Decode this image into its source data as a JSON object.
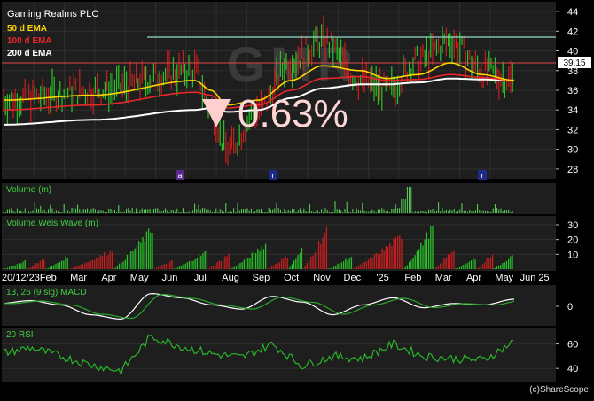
{
  "title": "Gaming Realms PLC",
  "watermark": "GMR",
  "change_text": "0.63%",
  "copyright": "(c)ShareScope",
  "legend": [
    {
      "label": "50 d  EMA",
      "color": "#ffd400"
    },
    {
      "label": "100 d  EMA",
      "color": "#e8262b"
    },
    {
      "label": "200 d  EMA",
      "color": "#ffffff"
    }
  ],
  "panel_labels": {
    "volume": "Volume (m)",
    "weis": "Volume Weis Wave (m)",
    "macd": "13, 26 (9 sig) MACD",
    "rsi": "20 RSI"
  },
  "event_markers": [
    "a",
    "r",
    "r"
  ],
  "colors": {
    "background": "#000000",
    "panel_bg": "#1e1e1e",
    "up_bar": "#28c228",
    "down_bar": "#c81e1e",
    "resistance_line": "#8fe0c8",
    "last_price_line": "#e04848",
    "price_tag_bg": "#ffffff",
    "marker_bg": "#4a2a7a"
  },
  "chart_data": [
    {
      "type": "line",
      "title": "Gaming Realms PLC",
      "series": [
        {
          "name": "50 d  EMA"
        },
        {
          "name": "100 d  EMA"
        },
        {
          "name": "200 d  EMA"
        }
      ],
      "x_ticks": [
        "20/12/23",
        "Feb",
        "Mar",
        "Apr",
        "May",
        "Jun",
        "Jul",
        "Aug",
        "Sep",
        "Oct",
        "Nov",
        "Dec",
        "'25",
        "Feb",
        "Mar",
        "Apr",
        "May",
        "Jun 25"
      ],
      "y_ticks": [
        28,
        30,
        32,
        34,
        36,
        38,
        40,
        42,
        44
      ],
      "ylim": [
        27,
        45
      ],
      "last_price": "39.15",
      "resistance_level": 41.6,
      "price_path_x": [
        0,
        2.8,
        6,
        6.5,
        7,
        8,
        9,
        10,
        11.2,
        12,
        13,
        14,
        15,
        16
      ],
      "price_path_y": [
        35,
        36,
        38,
        34,
        30,
        34,
        39,
        41,
        37,
        36,
        39,
        41,
        38,
        37
      ],
      "ema50_path": [
        35,
        35.5,
        37,
        36,
        34.5,
        35,
        37,
        38.5,
        38,
        37.2,
        37.6,
        38.8,
        37.6,
        37
      ],
      "ema100_path": [
        34,
        34.5,
        35.8,
        35.5,
        34.2,
        34.5,
        36,
        37.2,
        37.4,
        37,
        37.1,
        37.6,
        37.3,
        37
      ],
      "ema200_path": [
        32.5,
        33,
        34,
        34.2,
        33.8,
        34,
        35.2,
        36.2,
        36.6,
        36.6,
        36.8,
        37.2,
        37.1,
        37
      ]
    },
    {
      "type": "bar",
      "title": "Volume (m)",
      "y_ticks": [],
      "spike_index": 12.6
    },
    {
      "type": "bar",
      "title": "Volume Weis Wave (m)",
      "y_ticks": [
        30,
        20,
        10
      ],
      "ylim": [
        0,
        30
      ]
    },
    {
      "type": "line",
      "title": "13, 26 (9 sig) MACD",
      "y_ticks": [
        0
      ]
    },
    {
      "type": "line",
      "title": "20 RSI",
      "y_ticks": [
        60,
        40
      ],
      "ylim": [
        30,
        72
      ]
    }
  ]
}
